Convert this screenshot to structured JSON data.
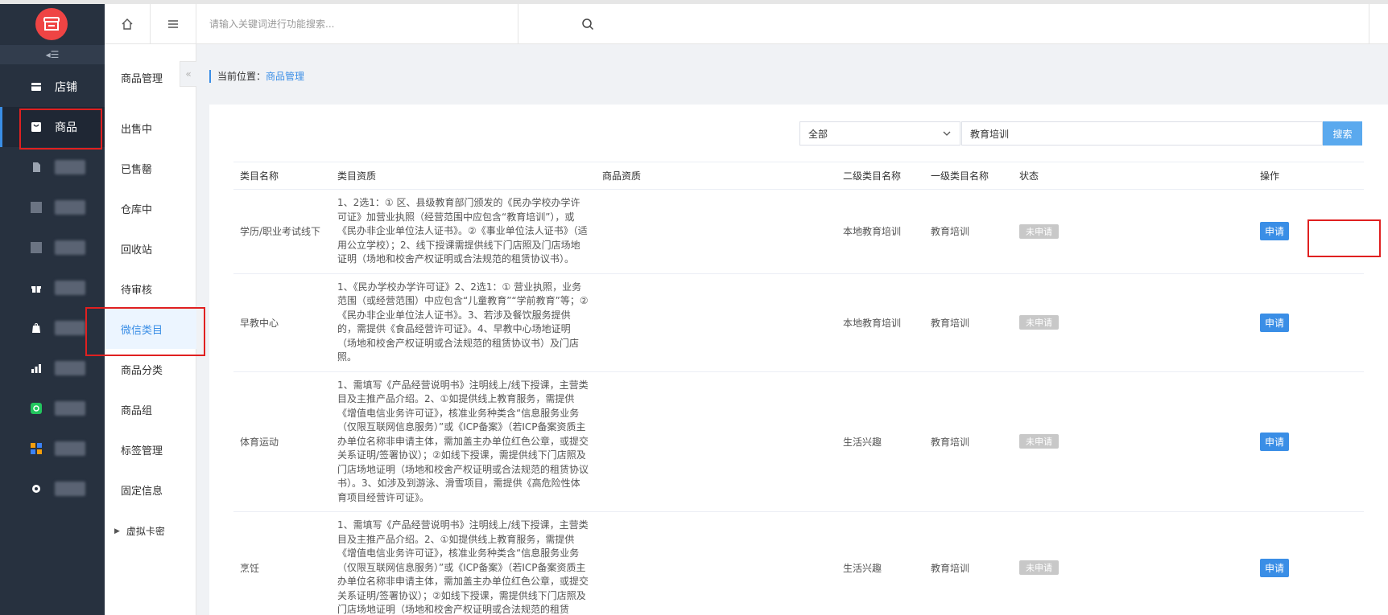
{
  "topbar": {
    "search_placeholder": "请输入关键词进行功能搜索..."
  },
  "sidebar": {
    "items": [
      {
        "label": "店铺",
        "icon": "shop-icon"
      },
      {
        "label": "商品",
        "icon": "product-icon"
      },
      {
        "label": "",
        "icon": "blurred-icon"
      },
      {
        "label": "",
        "icon": "blurred-icon"
      },
      {
        "label": "",
        "icon": "blurred-icon"
      },
      {
        "label": "",
        "icon": "gift-icon"
      },
      {
        "label": "",
        "icon": "bag-icon"
      },
      {
        "label": "",
        "icon": "chart-icon"
      },
      {
        "label": "",
        "icon": "mini-program-icon"
      },
      {
        "label": "",
        "icon": "apps-icon"
      },
      {
        "label": "",
        "icon": "gear-icon"
      }
    ]
  },
  "subnav": {
    "title": "商品管理",
    "fold_glyph": "«",
    "items": [
      "出售中",
      "已售罄",
      "仓库中",
      "回收站",
      "待审核",
      "微信类目",
      "商品分类",
      "商品组",
      "标签管理",
      "固定信息"
    ],
    "group": "虚拟卡密"
  },
  "breadcrumb": {
    "prefix": "当前位置：",
    "current": "商品管理"
  },
  "filter": {
    "select_value": "全部",
    "input_value": "教育培训",
    "search_label": "搜索"
  },
  "table": {
    "headers": [
      "类目名称",
      "类目资质",
      "商品资质",
      "二级类目名称",
      "一级类目名称",
      "状态",
      "操作"
    ],
    "rows": [
      {
        "name": "学历/职业考试线下",
        "qualification": "1、2选1：① 区、县级教育部门颁发的《民办学校办学许可证》加营业执照（经营范围中应包含“教育培训”），或《民办非企业单位法人证书》。②《事业单位法人证书》（适用公立学校）；2、线下授课需提供线下门店照及门店场地证明（场地和校舍产权证明或合法规范的租赁协议书）。",
        "product_qualification": "",
        "level2": "本地教育培训",
        "level1": "教育培训",
        "status": "未申请",
        "action": "申请"
      },
      {
        "name": "早教中心",
        "qualification": "1、《民办学校办学许可证》2、2选1：① 营业执照，业务范围（或经营范围）中应包含“儿童教育”“学前教育”等；②《民办非企业单位法人证书》。3、若涉及餐饮服务提供的，需提供《食品经营许可证》。4、早教中心场地证明（场地和校舍产权证明或合法规范的租赁协议书）及门店照。",
        "product_qualification": "",
        "level2": "本地教育培训",
        "level1": "教育培训",
        "status": "未申请",
        "action": "申请"
      },
      {
        "name": "体育运动",
        "qualification": "1、需填写《产品经营说明书》注明线上/线下授课，主营类目及主推产品介绍。2、①如提供线上教育服务，需提供《增值电信业务许可证》，核准业务种类含“信息服务业务（仅限互联网信息服务）”或《ICP备案》（若ICP备案资质主办单位名称非申请主体，需加盖主办单位红色公章，或提交关系证明/签署协议）；②如线下授课，需提供线下门店照及门店场地证明（场地和校舍产权证明或合法规范的租赁协议书）。3、如涉及到游泳、滑雪项目，需提供《高危险性体育项目经营许可证》。",
        "product_qualification": "",
        "level2": "生活兴趣",
        "level1": "教育培训",
        "status": "未申请",
        "action": "申请"
      },
      {
        "name": "烹饪",
        "qualification": "1、需填写《产品经营说明书》注明线上/线下授课，主营类目及主推产品介绍。2、①如提供线上教育服务，需提供《增值电信业务许可证》，核准业务种类含“信息服务业务（仅限互联网信息服务）”或《ICP备案》（若ICP备案资质主办单位名称非申请主体，需加盖主办单位红色公章，或提交关系证明/签署协议）；②如线下授课，需提供线下门店照及门店场地证明（场地和校舍产权证明或合法规范的租赁",
        "product_qualification": "",
        "level2": "生活兴趣",
        "level1": "教育培训",
        "status": "未申请",
        "action": "申请"
      }
    ]
  },
  "colors": {
    "sidebar_bg": "#27313f",
    "accent": "#3a8ee6",
    "logo_red": "#ef4444",
    "highlight_red": "#e02020"
  }
}
